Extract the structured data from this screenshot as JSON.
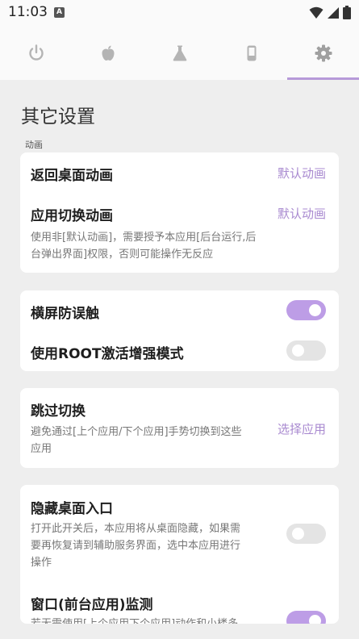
{
  "status_bar": {
    "time": "11:03",
    "notification_icon": "A"
  },
  "tabs": [
    {
      "icon": "power-icon",
      "active": false
    },
    {
      "icon": "apple-icon",
      "active": false
    },
    {
      "icon": "flask-icon",
      "active": false
    },
    {
      "icon": "phone-icon",
      "active": false
    },
    {
      "icon": "gear-icon",
      "active": true
    }
  ],
  "page": {
    "title": "其它设置",
    "section_animation": "动画"
  },
  "card_animation": {
    "home_anim_title": "返回桌面动画",
    "home_anim_value": "默认动画",
    "switch_anim_title": "应用切换动画",
    "switch_anim_value": "默认动画",
    "switch_anim_desc_l1": "使用非[默认动画]，需要授予本应用[后台运行,后",
    "switch_anim_desc_l2": "台弹出界面]权限，否则可能操作无反应"
  },
  "card_touch": {
    "landscape_title": "横屏防误触",
    "landscape_on": true,
    "root_title": "使用ROOT激活增强模式",
    "root_on": false
  },
  "card_skip": {
    "title": "跳过切换",
    "desc_l1": "避免通过[上个应用/下个应用]手势切换到这些",
    "desc_l2": "应用",
    "action": "选择应用"
  },
  "card_hide": {
    "hide_title": "隐藏桌面入口",
    "hide_desc_l1": "打开此开关后，本应用将从桌面隐藏，如果需",
    "hide_desc_l2": "要再恢复请到辅助服务界面，选中本应用进行",
    "hide_desc_l3": "操作",
    "hide_on": false,
    "window_title": "窗口(前台应用)监测",
    "window_desc_l1": "若无需使用[上个应用下个应用]动作和小楼多",
    "window_on": true
  },
  "colors": {
    "accent": "#a98ad0",
    "switch_on": "#bd9de6",
    "switch_off": "#e4e4e4",
    "background": "#eeeeee"
  }
}
